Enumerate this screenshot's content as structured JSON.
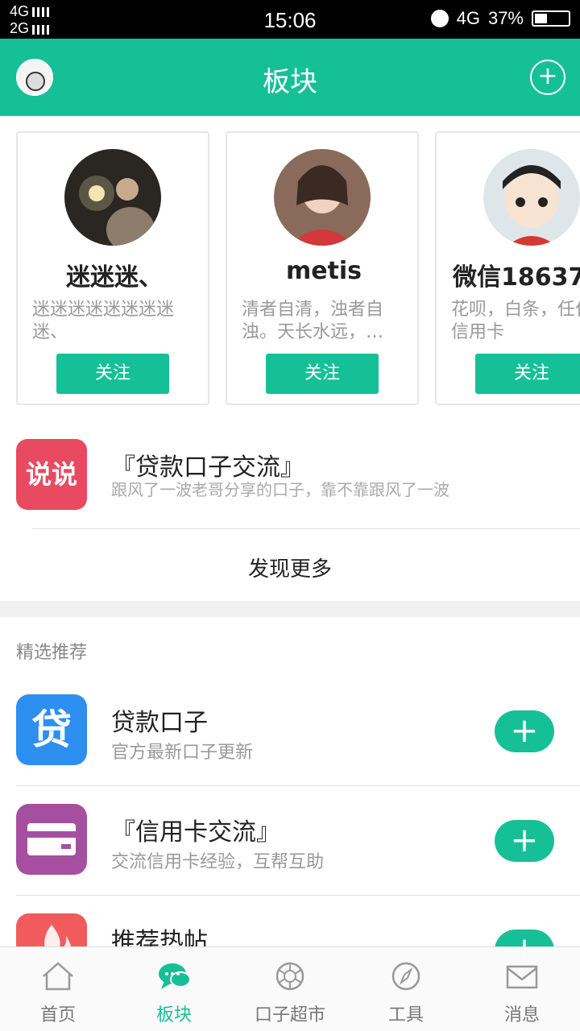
{
  "status_bar": {
    "network_top": "4G",
    "network_bottom": "2G",
    "time": "15:06",
    "data_type": "4G",
    "battery": "37%"
  },
  "header": {
    "title": "板块",
    "add_icon": "plus-circle-icon"
  },
  "user_cards": [
    {
      "name": "迷迷迷、",
      "bio": "迷迷迷迷迷迷迷迷迷、",
      "follow_label": "关注"
    },
    {
      "name": "metis",
      "bio": "清者自清，浊者自浊。天长水远，…",
      "follow_label": "关注"
    },
    {
      "name": "微信18637",
      "bio": "花呗，白条，任付，信用卡",
      "follow_label": "关注"
    }
  ],
  "post": {
    "icon_text": "说说",
    "title": "『贷款口子交流』",
    "excerpt": "跟风了一波老哥分享的口子，靠不靠跟风了一波"
  },
  "more_label": "发现更多",
  "section_title": "精选推荐",
  "recommended": [
    {
      "icon_text": "贷",
      "title": "贷款口子",
      "subtitle": "官方最新口子更新",
      "icon_color": "#2d8ff0"
    },
    {
      "icon_text": "",
      "title": "『信用卡交流』",
      "subtitle": "交流信用卡经验，互帮互助",
      "icon_color": "#a64fa0"
    },
    {
      "icon_text": "",
      "title": "推荐热帖",
      "subtitle": "",
      "icon_color": "#f25b5b"
    }
  ],
  "bottom_nav": [
    {
      "label": "首页",
      "icon": "home-icon",
      "active": false
    },
    {
      "label": "板块",
      "icon": "chat-bubbles-icon",
      "active": true
    },
    {
      "label": "口子超市",
      "icon": "shutter-icon",
      "active": false
    },
    {
      "label": "工具",
      "icon": "compass-icon",
      "active": false
    },
    {
      "label": "消息",
      "icon": "mail-icon",
      "active": false
    }
  ],
  "colors": {
    "accent": "#16c097"
  }
}
